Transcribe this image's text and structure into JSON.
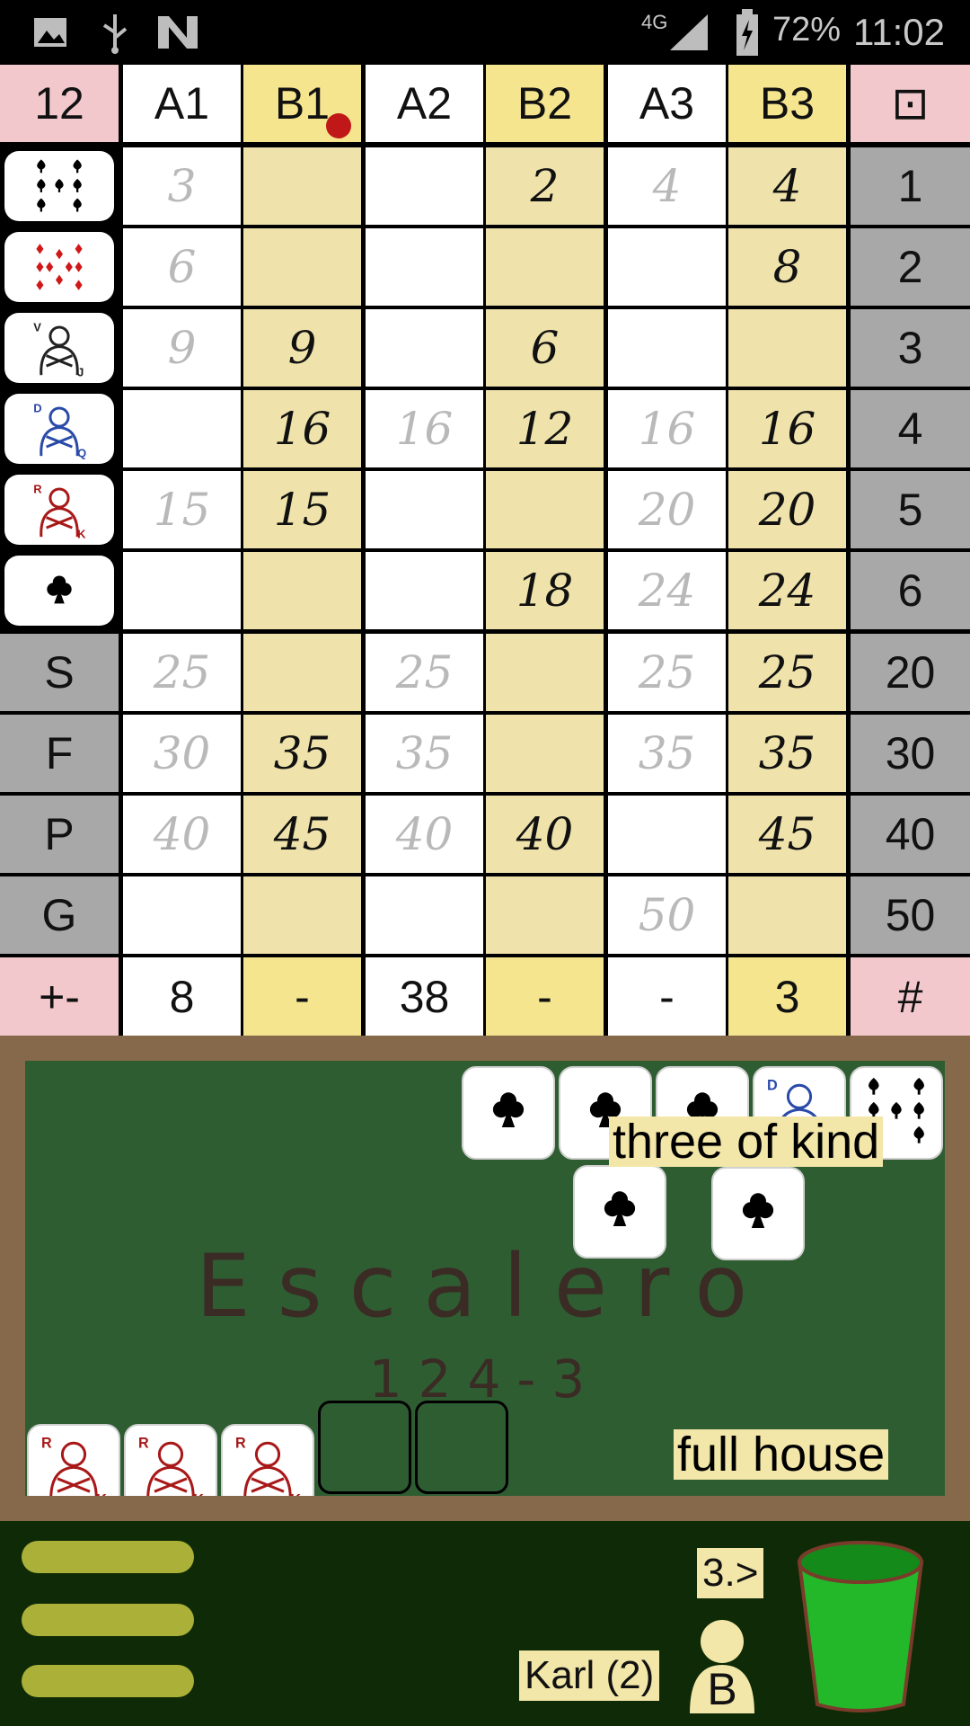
{
  "status_bar": {
    "network": "4G",
    "battery": "72%",
    "time": "11:02",
    "icons": [
      "image-icon",
      "usb-icon",
      "n-icon",
      "signal-icon",
      "battery-charging-icon"
    ]
  },
  "grid": {
    "round": "12",
    "columns": [
      "A1",
      "B1",
      "A2",
      "B2",
      "A3",
      "B3"
    ],
    "corner_right": "⊡",
    "row_icons": [
      "nine-spades-die-icon",
      "ten-diamonds-die-icon",
      "jack-die-icon",
      "queen-die-icon",
      "king-die-icon",
      "ace-clubs-die-icon"
    ],
    "special_labels": [
      "S",
      "F",
      "P",
      "G"
    ],
    "right_values": [
      "1",
      "2",
      "3",
      "4",
      "5",
      "6",
      "20",
      "30",
      "40",
      "50"
    ],
    "rows": [
      [
        {
          "v": "3",
          "s": "sugg"
        },
        {
          "v": "",
          "s": ""
        },
        {
          "v": "",
          "s": ""
        },
        {
          "v": "2",
          "s": "done"
        },
        {
          "v": "4",
          "s": "sugg"
        },
        {
          "v": "4",
          "s": "done"
        }
      ],
      [
        {
          "v": "6",
          "s": "sugg"
        },
        {
          "v": "",
          "s": ""
        },
        {
          "v": "",
          "s": ""
        },
        {
          "v": "",
          "s": ""
        },
        {
          "v": "",
          "s": ""
        },
        {
          "v": "8",
          "s": "done"
        }
      ],
      [
        {
          "v": "9",
          "s": "sugg"
        },
        {
          "v": "9",
          "s": "done"
        },
        {
          "v": "",
          "s": ""
        },
        {
          "v": "6",
          "s": "done"
        },
        {
          "v": "",
          "s": ""
        },
        {
          "v": "",
          "s": ""
        }
      ],
      [
        {
          "v": "",
          "s": ""
        },
        {
          "v": "16",
          "s": "done"
        },
        {
          "v": "16",
          "s": "sugg"
        },
        {
          "v": "12",
          "s": "done"
        },
        {
          "v": "16",
          "s": "sugg"
        },
        {
          "v": "16",
          "s": "done"
        }
      ],
      [
        {
          "v": "15",
          "s": "sugg"
        },
        {
          "v": "15",
          "s": "done"
        },
        {
          "v": "",
          "s": ""
        },
        {
          "v": "",
          "s": ""
        },
        {
          "v": "20",
          "s": "sugg"
        },
        {
          "v": "20",
          "s": "done"
        }
      ],
      [
        {
          "v": "",
          "s": ""
        },
        {
          "v": "",
          "s": ""
        },
        {
          "v": "",
          "s": ""
        },
        {
          "v": "18",
          "s": "done"
        },
        {
          "v": "24",
          "s": "sugg"
        },
        {
          "v": "24",
          "s": "done"
        }
      ],
      [
        {
          "v": "25",
          "s": "sugg"
        },
        {
          "v": "",
          "s": ""
        },
        {
          "v": "25",
          "s": "sugg"
        },
        {
          "v": "",
          "s": ""
        },
        {
          "v": "25",
          "s": "sugg"
        },
        {
          "v": "25",
          "s": "done"
        }
      ],
      [
        {
          "v": "30",
          "s": "sugg"
        },
        {
          "v": "35",
          "s": "done"
        },
        {
          "v": "35",
          "s": "sugg"
        },
        {
          "v": "",
          "s": ""
        },
        {
          "v": "35",
          "s": "sugg"
        },
        {
          "v": "35",
          "s": "done"
        }
      ],
      [
        {
          "v": "40",
          "s": "sugg"
        },
        {
          "v": "45",
          "s": "done"
        },
        {
          "v": "40",
          "s": "sugg"
        },
        {
          "v": "40",
          "s": "done"
        },
        {
          "v": "",
          "s": ""
        },
        {
          "v": "45",
          "s": "done"
        }
      ],
      [
        {
          "v": "",
          "s": ""
        },
        {
          "v": "",
          "s": ""
        },
        {
          "v": "",
          "s": ""
        },
        {
          "v": "",
          "s": ""
        },
        {
          "v": "50",
          "s": "sugg"
        },
        {
          "v": "",
          "s": ""
        }
      ]
    ],
    "totals_label": "+-",
    "totals": [
      "8",
      "-",
      "38",
      "-",
      "-",
      "3"
    ],
    "totals_right": "#"
  },
  "table": {
    "title": "Escalero",
    "subtitle": "124-3",
    "combo_top": "three of kind",
    "combo_bottom": "full house",
    "top_dice": [
      "ace-clubs-die-icon",
      "ace-clubs-die-icon",
      "ace-clubs-die-icon",
      "queen-die-icon",
      "nine-spades-die-icon"
    ],
    "rolled_dice": [
      "ace-clubs-die-icon",
      "ace-clubs-die-icon"
    ],
    "kept_dice": [
      "king-die-icon",
      "king-die-icon",
      "king-die-icon"
    ]
  },
  "bottom": {
    "next_label": "3.>",
    "player_label": "Karl (2)",
    "player_badge": "B",
    "icons": [
      "menu-icon",
      "player-icon",
      "dice-cup-icon"
    ]
  },
  "colors": {
    "pink": "#f2c8cc",
    "yellow": "#f5e58e",
    "felt": "#2f5d32",
    "cup": "#22b82a",
    "active_dot": "#c01818"
  }
}
